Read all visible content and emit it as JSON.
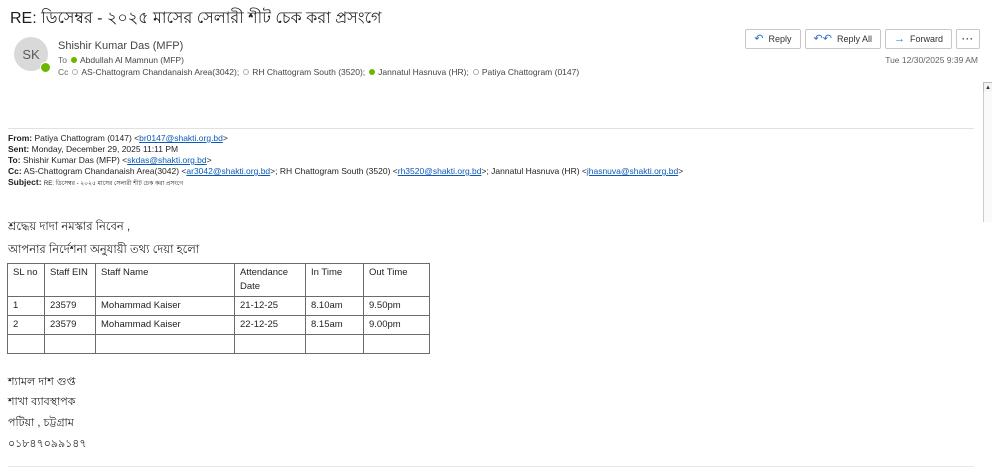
{
  "subject": "RE: ডিসেম্বর - ২০২৫ মাসের সেলারী শীট চেক করা প্রসংগে",
  "sender": {
    "initials": "SK",
    "name": "Shishir Kumar Das (MFP)"
  },
  "to": {
    "label": "To",
    "recipients": [
      {
        "name": "Abdullah Al Mamnun (MFP)",
        "status": "green"
      }
    ]
  },
  "cc": {
    "label": "Cc",
    "recipients": [
      {
        "name": "AS-Chattogram Chandanaish Area(3042);",
        "status": "empty"
      },
      {
        "name": "RH Chattogram South (3520);",
        "status": "empty"
      },
      {
        "name": "Jannatul Hasnuva (HR);",
        "status": "green"
      },
      {
        "name": "Patiya Chattogram (0147)",
        "status": "empty"
      }
    ]
  },
  "actions": {
    "reply": "Reply",
    "reply_all": "Reply All",
    "forward": "Forward",
    "more": "···"
  },
  "datetime": "Tue 12/30/2025 9:39 AM",
  "quoted": {
    "from_label": "From:",
    "from_text": "Patiya Chattogram (0147) <",
    "from_email": "br0147@shakti.org.bd",
    "from_end": ">",
    "sent_label": "Sent:",
    "sent_text": "Monday, December 29, 2025 11:11 PM",
    "to_label": "To:",
    "to_text": "Shishir Kumar Das (MFP) <",
    "to_email": "skdas@shakti.org.bd",
    "to_end": ">",
    "cc_label": "Cc:",
    "cc_text1": "AS-Chattogram Chandanaish Area(3042) <",
    "cc_email1": "ar3042@shakti.org.bd",
    "cc_text2": ">; RH Chattogram South (3520) <",
    "cc_email2": "rh3520@shakti.org.bd",
    "cc_text3": ">; Jannatul Hasnuva (HR) <",
    "cc_email3": "jhasnuva@shakti.org.bd",
    "cc_end": ">",
    "subject_label": "Subject:",
    "subject_text": "RE: ডিসেম্বর - ২০২৫ মাসের সেলারী শীট চেক করা প্রসংগে"
  },
  "body": {
    "greeting": "শ্রদ্ধেয় দাদা  নমস্কার নিবেন ,",
    "line2": "আপনার নির্দেশনা অনুযায়ী  তথ্য দেয়া হলো"
  },
  "table": {
    "headers": [
      "SL no",
      "Staff EIN",
      "Staff Name",
      "Attendance Date",
      "In Time",
      "Out Time"
    ],
    "rows": [
      [
        "1",
        "23579",
        "Mohammad Kaiser",
        "21-12-25",
        "8.10am",
        "9.50pm"
      ],
      [
        "2",
        "23579",
        "Mohammad Kaiser",
        "22-12-25",
        "8.15am",
        "9.00pm"
      ],
      [
        "",
        "",
        "",
        "",
        "",
        ""
      ]
    ]
  },
  "signature": [
    "শ্যামল দাশ গুপ্ত",
    "শাখা ব্যাবস্থাপক",
    "পটিয়া , চট্টগ্রাম",
    "০১৮৪৭০৯৯১৪৭"
  ]
}
